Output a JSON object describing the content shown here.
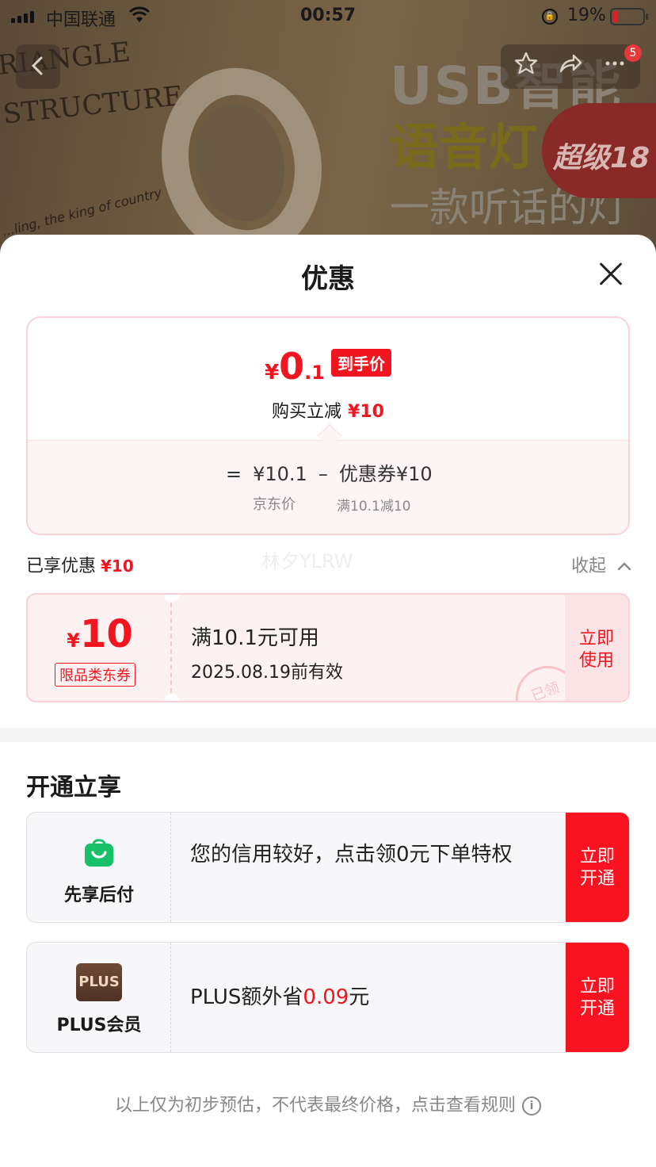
{
  "status_bar": {
    "carrier": "中国联通",
    "time": "00:57",
    "battery": "19%"
  },
  "background": {
    "text_left_1": "RIANGLE",
    "text_left_2": "STRUCTURE",
    "text_small": "...ling, the king of country",
    "usb_title": "USB智能",
    "lamp_title": "语音灯",
    "slogan": "一款听话的灯",
    "badge": "超级18"
  },
  "nav": {
    "cart_badge": "5"
  },
  "sheet": {
    "title": "优惠",
    "price": {
      "symbol": "¥",
      "integer": "0",
      "decimal": ".1",
      "tag": "到手价",
      "subtitle": "购买立减",
      "subtitle_amount": "¥10",
      "formula_eq": "=",
      "formula_jd": "¥10.1",
      "formula_minus": "–",
      "formula_coupon": "优惠券¥10",
      "label_jd": "京东价",
      "label_coupon": "满10.1减10"
    },
    "watermark": "林夕YLRW",
    "enjoyed": {
      "label": "已享优惠",
      "amount": "¥10",
      "collapse": "收起"
    },
    "coupon": {
      "symbol": "¥",
      "amount": "10",
      "type": "限品类东券",
      "condition": "满10.1元可用",
      "expiry": "2025.08.19前有效",
      "use_line1": "立即",
      "use_line2": "使用",
      "stamp": "已领"
    },
    "section_title": "开通立享",
    "offers": [
      {
        "label": "先享后付",
        "text": "您的信用较好，点击领0元下单特权",
        "btn_line1": "立即",
        "btn_line2": "开通"
      },
      {
        "label": "PLUS会员",
        "icon_text": "PLUS",
        "text_prefix": "PLUS额外省",
        "text_amount": "0.09",
        "text_suffix": "元",
        "btn_line1": "立即",
        "btn_line2": "开通"
      }
    ],
    "footer_note": "以上仅为初步预估，不代表最终价格，点击查看规则"
  },
  "colors": {
    "accent_red": "#f2151f",
    "pink_border": "#fad1d4",
    "green_bag": "#19c06a",
    "plus_brown": "#5e3c2c"
  }
}
